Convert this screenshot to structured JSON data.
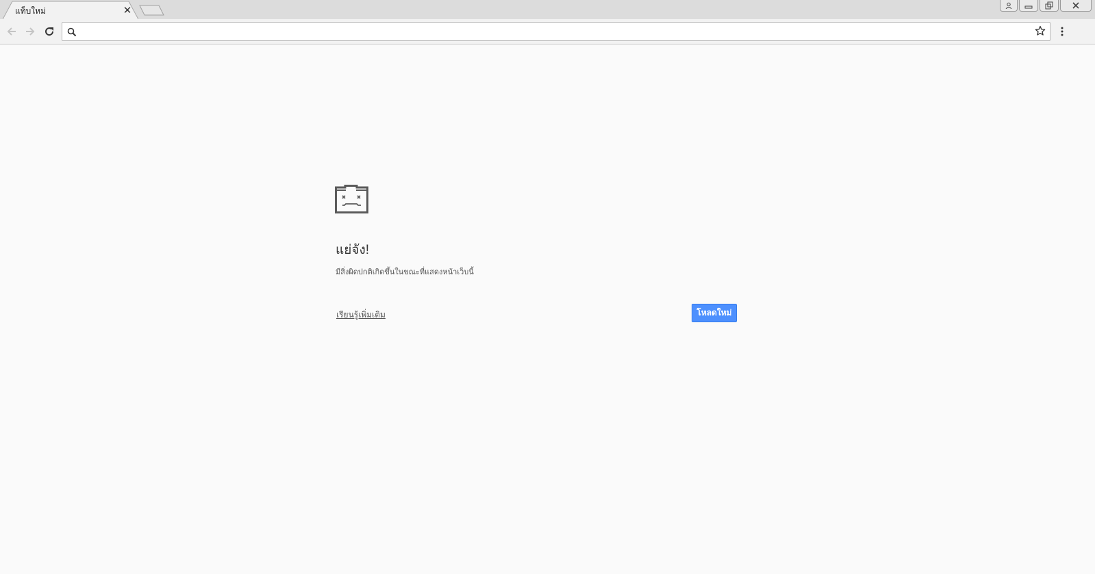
{
  "window": {
    "tab_title": "แท็บใหม่",
    "tab_close_icon": "close-icon",
    "new_tab_icon": "new-tab-icon",
    "controls": [
      "profile-icon",
      "minimize-icon",
      "restore-icon",
      "close-window-icon"
    ]
  },
  "toolbar": {
    "back_icon": "arrow-left-icon",
    "forward_icon": "arrow-right-icon",
    "reload_icon": "reload-icon",
    "omnibox_value": "",
    "search_icon": "search-icon",
    "bookmark_icon": "star-icon",
    "menu_icon": "kebab-menu-icon"
  },
  "error_page": {
    "icon": "sad-folder-icon",
    "title": "แย่จัง!",
    "description": "มีสิ่งผิดปกติเกิดขึ้นในขณะที่แสดงหน้าเว็บนี้",
    "learn_more": "เรียนรู้เพิ่มเติม",
    "reload_button": "โหลดใหม่"
  },
  "colors": {
    "accent": "#4d90fe",
    "page_background": "#fafafa",
    "tabstrip": "#dcdcdc"
  }
}
